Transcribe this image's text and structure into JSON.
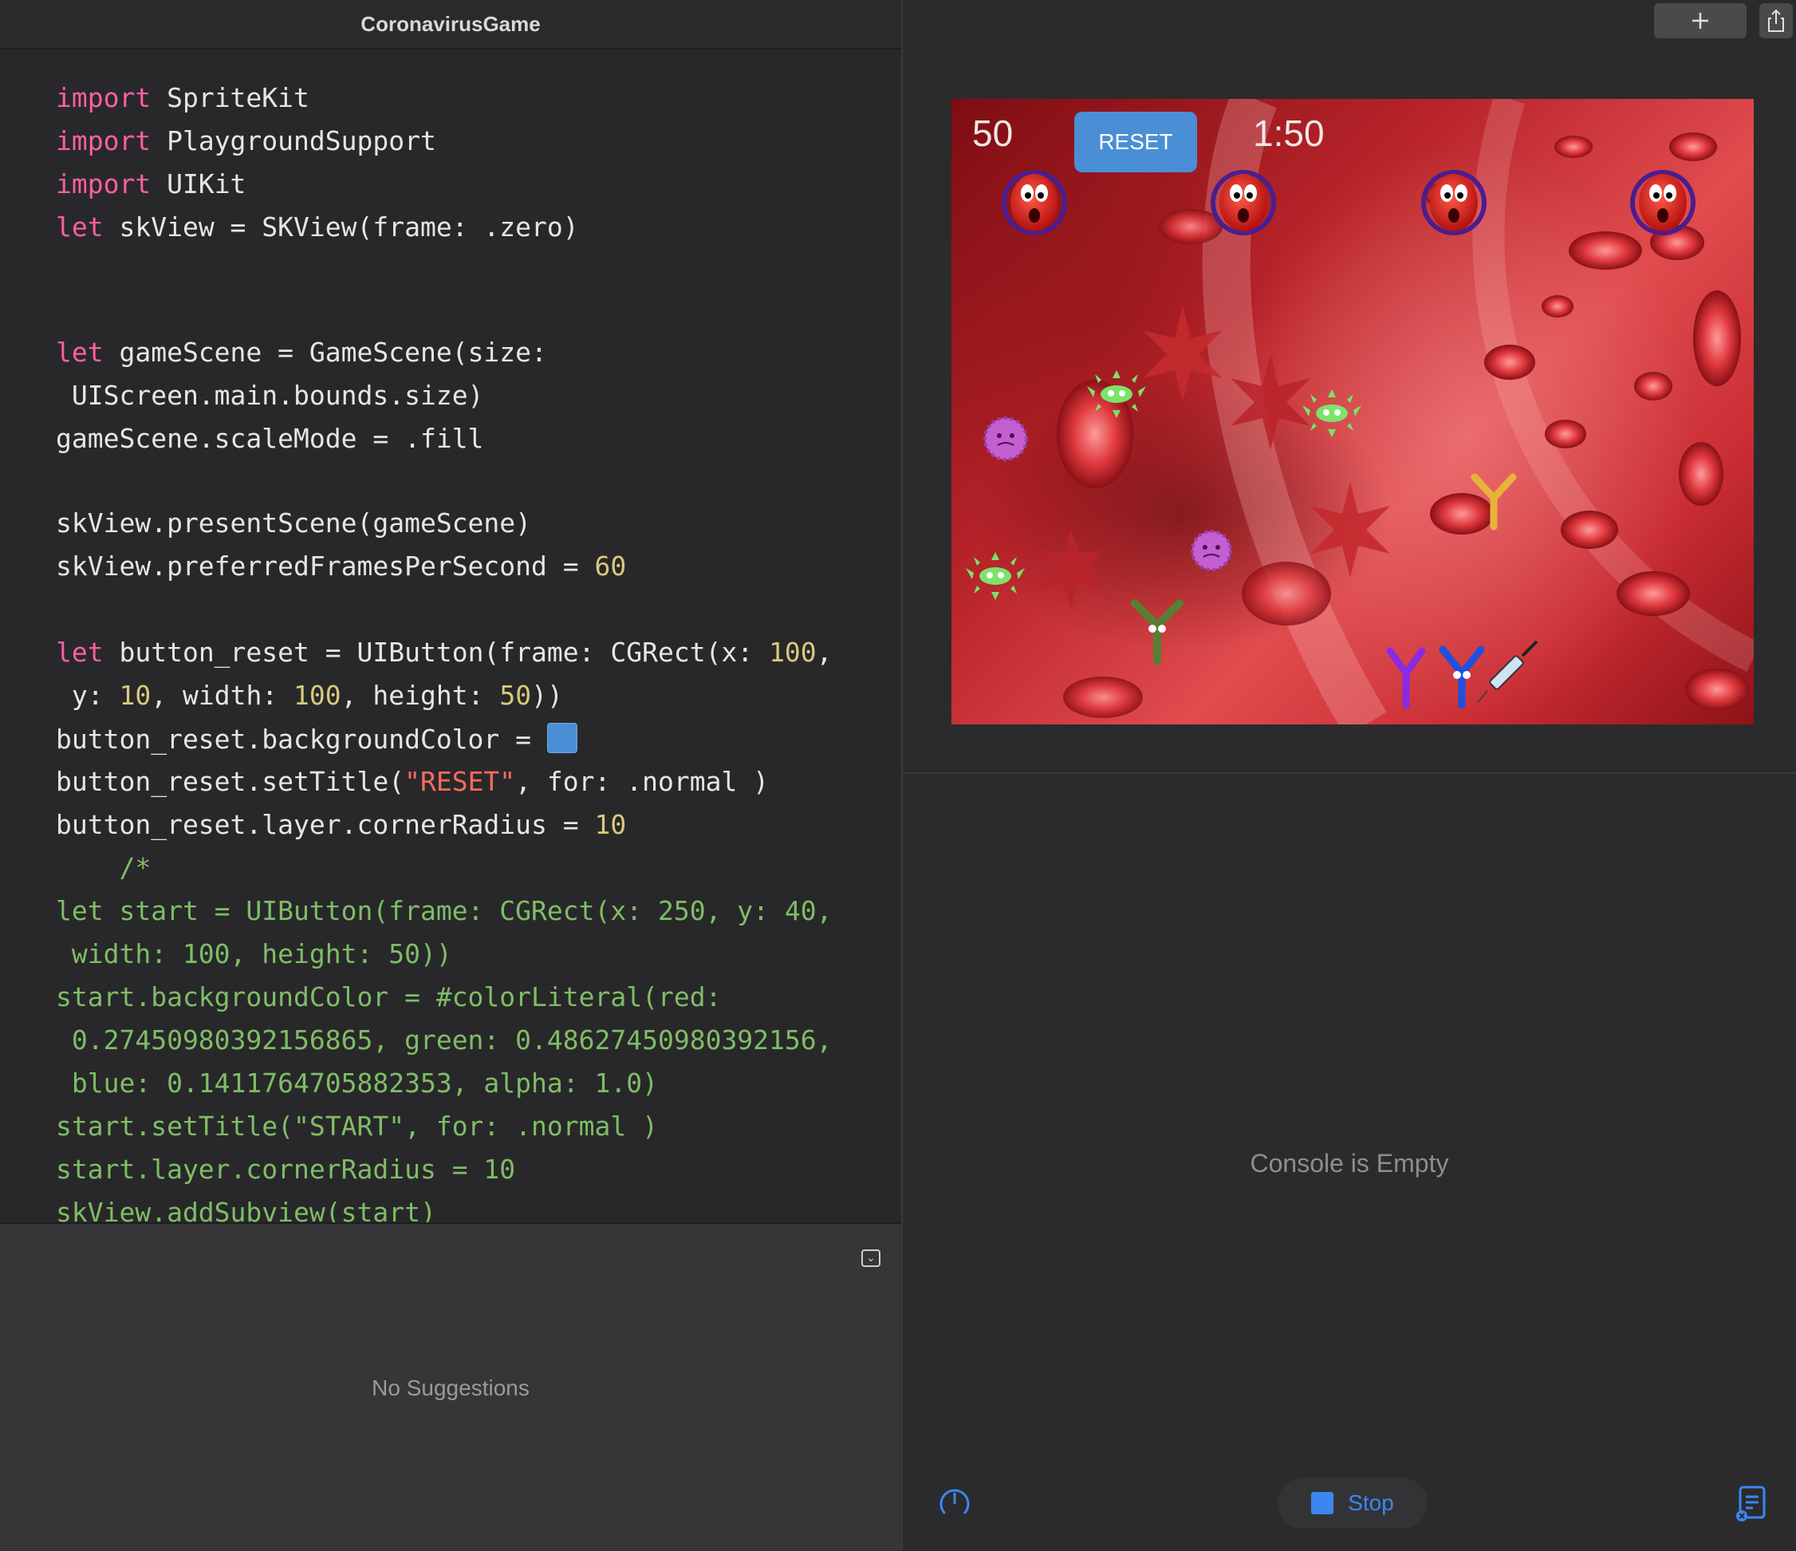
{
  "window": {
    "title": "CoronavirusGame"
  },
  "toolbar": {
    "add_icon": "plus-icon",
    "share_icon": "share-icon"
  },
  "editor": {
    "lines": [
      {
        "tokens": [
          {
            "t": "import",
            "c": "kw"
          },
          {
            "t": " SpriteKit",
            "c": "plain"
          }
        ]
      },
      {
        "tokens": [
          {
            "t": "import",
            "c": "kw"
          },
          {
            "t": " PlaygroundSupport",
            "c": "plain"
          }
        ]
      },
      {
        "tokens": [
          {
            "t": "import",
            "c": "kw"
          },
          {
            "t": " UIKit",
            "c": "plain"
          }
        ]
      },
      {
        "tokens": [
          {
            "t": "let",
            "c": "kw"
          },
          {
            "t": " skView = SKView(frame: .zero)",
            "c": "plain"
          }
        ]
      },
      {
        "tokens": [
          {
            "t": "let",
            "c": "kw"
          },
          {
            "t": " gameScene = GameScene(size:",
            "c": "plain"
          }
        ]
      },
      {
        "tokens": [
          {
            "t": " UIScreen.main.bounds.size)",
            "c": "plain"
          }
        ]
      },
      {
        "tokens": [
          {
            "t": "gameScene.scaleMode = .fill",
            "c": "plain"
          }
        ]
      },
      {
        "tokens": [
          {
            "t": "skView.presentScene(gameScene)",
            "c": "plain"
          }
        ]
      },
      {
        "tokens": [
          {
            "t": "skView.preferredFramesPerSecond = ",
            "c": "plain"
          },
          {
            "t": "60",
            "c": "num"
          }
        ]
      },
      {
        "tokens": [
          {
            "t": "let",
            "c": "kw"
          },
          {
            "t": " button_reset = UIButton(frame: CGRect(x: ",
            "c": "plain"
          },
          {
            "t": "100",
            "c": "num"
          },
          {
            "t": ",",
            "c": "plain"
          }
        ]
      },
      {
        "tokens": [
          {
            "t": " y: ",
            "c": "plain"
          },
          {
            "t": "10",
            "c": "num"
          },
          {
            "t": ", width: ",
            "c": "plain"
          },
          {
            "t": "100",
            "c": "num"
          },
          {
            "t": ", height: ",
            "c": "plain"
          },
          {
            "t": "50",
            "c": "num"
          },
          {
            "t": "))",
            "c": "plain"
          }
        ]
      },
      {
        "tokens": [
          {
            "t": "button_reset.backgroundColor = ",
            "c": "plain"
          },
          {
            "t": "",
            "c": "swatch"
          }
        ]
      },
      {
        "tokens": [
          {
            "t": "button_reset.setTitle(",
            "c": "plain"
          },
          {
            "t": "\"RESET\"",
            "c": "str"
          },
          {
            "t": ", for: .normal )",
            "c": "plain"
          }
        ]
      },
      {
        "tokens": [
          {
            "t": "button_reset.layer.cornerRadius = ",
            "c": "plain"
          },
          {
            "t": "10",
            "c": "num"
          }
        ]
      },
      {
        "tokens": [
          {
            "t": "    /*",
            "c": "cm"
          }
        ]
      },
      {
        "tokens": [
          {
            "t": "let start = UIButton(frame: CGRect(x: 250, y: 40,",
            "c": "cm"
          }
        ]
      },
      {
        "tokens": [
          {
            "t": " width: 100, height: 50))",
            "c": "cm"
          }
        ]
      },
      {
        "tokens": [
          {
            "t": "start.backgroundColor = #colorLiteral(red:",
            "c": "cm"
          }
        ]
      },
      {
        "tokens": [
          {
            "t": " 0.27450980392156865, green: 0.48627450980392156,",
            "c": "cm"
          }
        ]
      },
      {
        "tokens": [
          {
            "t": " blue: 0.1411764705882353, alpha: 1.0)",
            "c": "cm"
          }
        ]
      },
      {
        "tokens": [
          {
            "t": "start.setTitle(\"START\", for: .normal )",
            "c": "cm"
          }
        ]
      },
      {
        "tokens": [
          {
            "t": "start.layer.cornerRadius = 10",
            "c": "cm"
          }
        ]
      },
      {
        "tokens": [
          {
            "t": "skView.addSubview(start)",
            "c": "cm"
          }
        ]
      }
    ],
    "swatch_color": "#4a8fd6"
  },
  "suggestions": {
    "empty_text": "No Suggestions",
    "collapse_icon": "collapse-icon"
  },
  "game": {
    "score": "50",
    "reset_label": "RESET",
    "timer": "1:50",
    "reset_color": "#4a8fd6"
  },
  "console": {
    "empty_text": "Console is Empty"
  },
  "bottom_bar": {
    "gauge_icon": "gauge-icon",
    "stop_label": "Stop",
    "stop_icon": "stop-icon",
    "log_icon": "log-icon",
    "accent": "#3d86f2"
  }
}
